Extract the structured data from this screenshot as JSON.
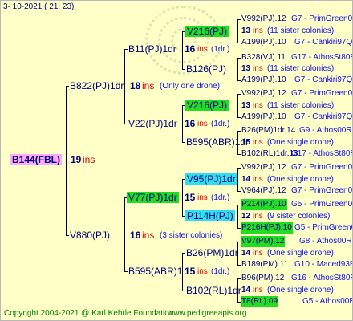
{
  "header": {
    "date": "3-  10-2021  ( 21: 23)"
  },
  "footer": {
    "copyright": "Copyright 2004-2021 @ Karl Kehrle Foundation",
    "site": "www.pedigreeapis.org"
  },
  "root": {
    "name": "B144(FBL)",
    "count": "19",
    "ins": "ins"
  },
  "gen1": [
    {
      "name": "B822(PJ)1dr",
      "count": "18",
      "ins": "ins",
      "note": "(Only one drone)"
    },
    {
      "name": "V880(PJ)",
      "count": "16",
      "ins": "ins",
      "note": "(3 sister colonies)"
    }
  ],
  "gen2": [
    {
      "name": "B11(PJ)1dr",
      "count": "16",
      "ins": "ins",
      "note": "(1dr.)"
    },
    {
      "name": "V22(PJ)1dr",
      "count": "16",
      "ins": "ins",
      "note": "(1dr.)"
    },
    {
      "name": "V77(PJ)1dr",
      "count": "15",
      "ins": "ins",
      "note": "(1dr.)"
    },
    {
      "name": "B595(ABR)1",
      "count": "15",
      "ins": "ins",
      "note": "(1dr.)"
    }
  ],
  "gen3": [
    {
      "name": "V216(PJ)",
      "count": "16",
      "ins": "ins",
      "note": "(1dr.)"
    },
    {
      "name": "B126(PJ)",
      "count": "",
      "ins": "",
      "note": ""
    },
    {
      "name": "V216(PJ)",
      "count": "16",
      "ins": "ins",
      "note": "(1dr.)"
    },
    {
      "name": "B595(ABR)1dr",
      "count": "",
      "ins": "",
      "note": ""
    },
    {
      "name": "V95(PJ)1dr",
      "count": "",
      "ins": "",
      "note": ""
    },
    {
      "name": "P114H(PJ)",
      "count": "",
      "ins": "",
      "note": ""
    },
    {
      "name": "B26(PM)1dr",
      "count": "14",
      "ins": "ins",
      "note": "(1dr.)"
    },
    {
      "name": "B102(RL)1dr",
      "count": "",
      "ins": "",
      "note": ""
    }
  ],
  "gen4": [
    {
      "name": "V992(PJ).12",
      "info": "G7 - PrimGreen00"
    },
    {
      "count": "13",
      "ins": "ins",
      "note": "(11 sister colonies)"
    },
    {
      "name": "A199(PJ).10",
      "info": "G7 - Cankiri97Q"
    },
    {
      "name": "B328(VJ).11",
      "info": "G17 - AthosSt80R"
    },
    {
      "count": "13",
      "ins": "ins",
      "note": "(11 sister colonies)"
    },
    {
      "name": "A199(PJ).10",
      "info": "G7 - Cankiri97Q"
    },
    {
      "name": "V992(PJ).12",
      "info": "G7 - PrimGreen00"
    },
    {
      "count": "13",
      "ins": "ins",
      "note": "(11 sister colonies)"
    },
    {
      "name": "A199(PJ).10",
      "info": "G7 - Cankiri97Q"
    },
    {
      "name": "B26(PM)1dr.14",
      "info": "G9 - Athos00R"
    },
    {
      "count": "15",
      "ins": "ins",
      "note": "(One single drone)"
    },
    {
      "name": "B102(RL)1dr.13",
      "info": "G17 - AthosSt80R"
    },
    {
      "name": "V992(PJ).12",
      "info": "G7 - PrimGreen00"
    },
    {
      "count": "14",
      "ins": "ins",
      "note": "(One single drone)"
    },
    {
      "name": "V964(PJ).12",
      "info": "G7 - PrimGreen00"
    },
    {
      "name": "P214(PJ).10",
      "info": "G5 - PrimGreen00"
    },
    {
      "count": "12",
      "ins": "ins",
      "note": "(9 sister colonies)"
    },
    {
      "name": "P216H(PJ).10",
      "info": "G5 - PrimGreen00"
    },
    {
      "name": "V97(PM).12",
      "info": "G8 - Athos00R"
    },
    {
      "count": "14",
      "ins": "ins",
      "note": "(One single drone)"
    },
    {
      "name": "B189(PM).11",
      "info": "G10 - Maced93R"
    },
    {
      "name": "B96(PM).12",
      "info": "G16 - AthosSt80R"
    },
    {
      "count": "14",
      "ins": "ins",
      "note": "(One single drone)"
    },
    {
      "name": "T8(RL).09",
      "info": "G5 - Athos00R"
    }
  ]
}
